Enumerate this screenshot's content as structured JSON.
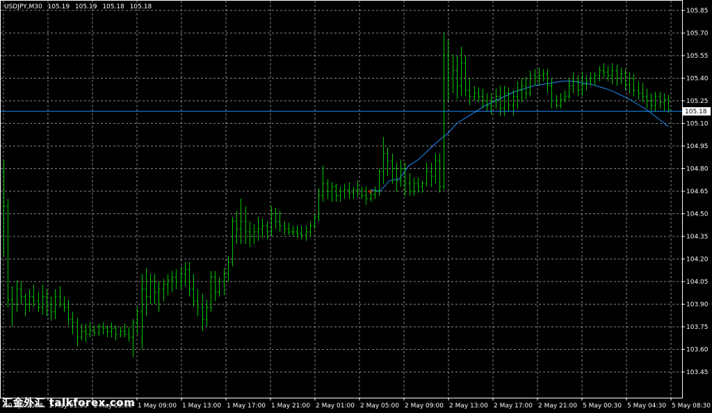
{
  "header": {
    "symbol": "USDJPY,M30",
    "open": "105.19",
    "high": "105.19",
    "low": "105.18",
    "close": "105.18"
  },
  "watermark": "汇金外汇 talkforex.com",
  "colors": {
    "background": "#000000",
    "grid": "#c0c0c0",
    "bars": "#00c800",
    "ma_line": "#1e90ff",
    "price_line": "#1e90ff",
    "arrow": "#ff0000",
    "axis_text": "#ffffff"
  },
  "chart_data": {
    "type": "ohlc",
    "price_label": "105.18",
    "ylim": [
      103.4,
      105.88
    ],
    "y_ticks": [
      "105.85",
      "105.70",
      "105.55",
      "105.40",
      "105.25",
      "105.10",
      "104.95",
      "104.80",
      "104.65",
      "104.50",
      "104.35",
      "104.20",
      "104.05",
      "103.90",
      "103.75",
      "103.60",
      "103.45"
    ],
    "x_ticks": [
      "30 Apr 2008",
      "1 May 01:00",
      "1 May 05:00",
      "1 May 09:00",
      "1 May 13:00",
      "1 May 17:00",
      "1 May 21:00",
      "2 May 01:00",
      "2 May 05:00",
      "2 May 09:00",
      "2 May 13:00",
      "2 May 17:00",
      "2 May 21:00",
      "5 May 00:30",
      "5 May 04:30",
      "5 May 08:30"
    ],
    "current_price": 105.18,
    "bars": [
      [
        104.78,
        104.86,
        104.22,
        104.55
      ],
      [
        104.55,
        104.6,
        103.88,
        103.93
      ],
      [
        103.93,
        104.02,
        103.75,
        103.9
      ],
      [
        103.9,
        104.06,
        103.85,
        104.0
      ],
      [
        104.0,
        104.05,
        103.9,
        103.95
      ],
      [
        103.95,
        103.97,
        103.82,
        103.9
      ],
      [
        103.9,
        104.0,
        103.85,
        103.95
      ],
      [
        103.95,
        104.03,
        103.88,
        103.92
      ],
      [
        103.92,
        103.98,
        103.85,
        103.88
      ],
      [
        103.88,
        104.03,
        103.83,
        103.95
      ],
      [
        103.95,
        104.0,
        103.82,
        103.9
      ],
      [
        103.9,
        103.95,
        103.79,
        103.85
      ],
      [
        103.85,
        104.0,
        103.8,
        103.95
      ],
      [
        103.95,
        104.02,
        103.88,
        103.9
      ],
      [
        103.9,
        103.95,
        103.85,
        103.88
      ],
      [
        103.88,
        103.93,
        103.76,
        103.8
      ],
      [
        103.8,
        103.85,
        103.7,
        103.78
      ],
      [
        103.78,
        103.81,
        103.62,
        103.68
      ],
      [
        103.68,
        103.77,
        103.66,
        103.72
      ],
      [
        103.72,
        103.77,
        103.65,
        103.7
      ],
      [
        103.7,
        103.78,
        103.68,
        103.73
      ],
      [
        103.73,
        103.76,
        103.69,
        103.71
      ],
      [
        103.71,
        103.77,
        103.69,
        103.75
      ],
      [
        103.75,
        103.78,
        103.7,
        103.74
      ],
      [
        103.74,
        103.76,
        103.68,
        103.72
      ],
      [
        103.72,
        103.78,
        103.68,
        103.74
      ],
      [
        103.74,
        103.76,
        103.66,
        103.7
      ],
      [
        103.7,
        103.75,
        103.68,
        103.72
      ],
      [
        103.72,
        103.77,
        103.68,
        103.7
      ],
      [
        103.7,
        103.75,
        103.65,
        103.68
      ],
      [
        103.68,
        103.8,
        103.55,
        103.78
      ],
      [
        103.78,
        103.88,
        103.7,
        103.85
      ],
      [
        103.85,
        104.1,
        103.6,
        104.0
      ],
      [
        104.0,
        104.14,
        103.82,
        103.95
      ],
      [
        103.95,
        104.1,
        103.9,
        104.05
      ],
      [
        104.05,
        104.1,
        103.9,
        103.98
      ],
      [
        103.98,
        104.05,
        103.85,
        104.0
      ],
      [
        104.0,
        104.07,
        103.92,
        104.03
      ],
      [
        104.03,
        104.1,
        103.96,
        104.06
      ],
      [
        104.06,
        104.12,
        103.98,
        104.08
      ],
      [
        104.08,
        104.13,
        104.0,
        104.05
      ],
      [
        104.05,
        104.15,
        104.0,
        104.1
      ],
      [
        104.1,
        104.18,
        104.02,
        104.13
      ],
      [
        104.13,
        104.18,
        103.95,
        104.0
      ],
      [
        104.0,
        104.1,
        103.88,
        103.92
      ],
      [
        103.92,
        104.0,
        103.82,
        103.88
      ],
      [
        103.88,
        103.97,
        103.72,
        103.8
      ],
      [
        103.8,
        103.93,
        103.75,
        103.88
      ],
      [
        103.88,
        104.12,
        103.85,
        104.08
      ],
      [
        104.08,
        104.12,
        103.92,
        103.98
      ],
      [
        103.98,
        104.08,
        103.95,
        104.05
      ],
      [
        104.05,
        104.14,
        103.96,
        104.1
      ],
      [
        104.1,
        104.22,
        104.05,
        104.18
      ],
      [
        104.18,
        104.48,
        104.15,
        104.45
      ],
      [
        104.45,
        104.52,
        104.3,
        104.4
      ],
      [
        104.4,
        104.6,
        104.3,
        104.45
      ],
      [
        104.45,
        104.55,
        104.3,
        104.38
      ],
      [
        104.38,
        104.45,
        104.28,
        104.35
      ],
      [
        104.35,
        104.43,
        104.3,
        104.38
      ],
      [
        104.38,
        104.48,
        104.32,
        104.4
      ],
      [
        104.4,
        104.47,
        104.34,
        104.42
      ],
      [
        104.42,
        104.45,
        104.33,
        104.38
      ],
      [
        104.38,
        104.55,
        104.35,
        104.5
      ],
      [
        104.5,
        104.54,
        104.4,
        104.45
      ],
      [
        104.45,
        104.52,
        104.38,
        104.42
      ],
      [
        104.42,
        104.45,
        104.36,
        104.4
      ],
      [
        104.4,
        104.44,
        104.36,
        104.38
      ],
      [
        104.38,
        104.42,
        104.35,
        104.38
      ],
      [
        104.38,
        104.42,
        104.34,
        104.37
      ],
      [
        104.37,
        104.42,
        104.33,
        104.36
      ],
      [
        104.36,
        104.42,
        104.32,
        104.38
      ],
      [
        104.38,
        104.45,
        104.35,
        104.42
      ],
      [
        104.42,
        104.5,
        104.4,
        104.48
      ],
      [
        104.48,
        104.67,
        104.45,
        104.62
      ],
      [
        104.62,
        104.82,
        104.58,
        104.7
      ],
      [
        104.7,
        104.73,
        104.6,
        104.65
      ],
      [
        104.65,
        104.71,
        104.58,
        104.68
      ],
      [
        104.68,
        104.7,
        104.58,
        104.62
      ],
      [
        104.62,
        104.68,
        104.58,
        104.65
      ],
      [
        104.65,
        104.7,
        104.6,
        104.66
      ],
      [
        104.66,
        104.71,
        104.6,
        104.64
      ],
      [
        104.64,
        104.68,
        104.6,
        104.66
      ],
      [
        104.66,
        104.72,
        104.61,
        104.65
      ],
      [
        104.65,
        104.68,
        104.6,
        104.62
      ],
      [
        104.62,
        104.68,
        104.56,
        104.6
      ],
      [
        104.6,
        104.66,
        104.58,
        104.63
      ],
      [
        104.63,
        104.68,
        104.6,
        104.65
      ],
      [
        104.65,
        104.8,
        104.62,
        104.78
      ],
      [
        104.78,
        105.01,
        104.7,
        104.9
      ],
      [
        104.9,
        104.94,
        104.75,
        104.85
      ],
      [
        104.85,
        104.9,
        104.7,
        104.8
      ],
      [
        104.8,
        104.84,
        104.65,
        104.72
      ],
      [
        104.72,
        104.86,
        104.68,
        104.8
      ],
      [
        104.8,
        104.84,
        104.62,
        104.7
      ],
      [
        104.7,
        104.77,
        104.62,
        104.65
      ],
      [
        104.65,
        104.74,
        104.62,
        104.7
      ],
      [
        104.7,
        104.74,
        104.64,
        104.68
      ],
      [
        104.68,
        104.72,
        104.64,
        104.7
      ],
      [
        104.7,
        104.84,
        104.68,
        104.78
      ],
      [
        104.78,
        104.84,
        104.68,
        104.75
      ],
      [
        104.75,
        104.9,
        104.7,
        104.85
      ],
      [
        104.85,
        104.9,
        104.64,
        104.68
      ],
      [
        104.68,
        105.7,
        104.66,
        105.55
      ],
      [
        105.55,
        105.66,
        105.25,
        105.4
      ],
      [
        105.4,
        105.56,
        105.3,
        105.45
      ],
      [
        105.45,
        105.55,
        105.26,
        105.35
      ],
      [
        105.35,
        105.61,
        105.28,
        105.5
      ],
      [
        105.5,
        105.55,
        105.28,
        105.32
      ],
      [
        105.32,
        105.4,
        105.22,
        105.28
      ],
      [
        105.28,
        105.35,
        105.25,
        105.3
      ],
      [
        105.3,
        105.34,
        105.24,
        105.28
      ],
      [
        105.28,
        105.33,
        105.2,
        105.25
      ],
      [
        105.25,
        105.3,
        105.18,
        105.22
      ],
      [
        105.22,
        105.3,
        105.16,
        105.25
      ],
      [
        105.25,
        105.33,
        105.2,
        105.28
      ],
      [
        105.28,
        105.35,
        105.15,
        105.2
      ],
      [
        105.2,
        105.35,
        105.15,
        105.3
      ],
      [
        105.3,
        105.34,
        105.18,
        105.22
      ],
      [
        105.22,
        105.32,
        105.15,
        105.28
      ],
      [
        105.28,
        105.38,
        105.2,
        105.32
      ],
      [
        105.32,
        105.4,
        105.24,
        105.35
      ],
      [
        105.35,
        105.41,
        105.26,
        105.3
      ],
      [
        105.3,
        105.45,
        105.28,
        105.42
      ],
      [
        105.42,
        105.46,
        105.35,
        105.4
      ],
      [
        105.4,
        105.47,
        105.35,
        105.42
      ],
      [
        105.42,
        105.46,
        105.38,
        105.43
      ],
      [
        105.43,
        105.46,
        105.3,
        105.35
      ],
      [
        105.35,
        105.4,
        105.2,
        105.25
      ],
      [
        105.25,
        105.29,
        105.2,
        105.22
      ],
      [
        105.22,
        105.3,
        105.2,
        105.26
      ],
      [
        105.26,
        105.32,
        105.24,
        105.28
      ],
      [
        105.28,
        105.4,
        105.26,
        105.35
      ],
      [
        105.35,
        105.44,
        105.3,
        105.38
      ],
      [
        105.38,
        105.42,
        105.28,
        105.32
      ],
      [
        105.32,
        105.44,
        105.28,
        105.36
      ],
      [
        105.36,
        105.42,
        105.32,
        105.38
      ],
      [
        105.38,
        105.44,
        105.35,
        105.4
      ],
      [
        105.4,
        105.44,
        105.35,
        105.42
      ],
      [
        105.42,
        105.48,
        105.38,
        105.45
      ],
      [
        105.45,
        105.5,
        105.4,
        105.44
      ],
      [
        105.44,
        105.48,
        105.38,
        105.42
      ],
      [
        105.42,
        105.5,
        105.36,
        105.45
      ],
      [
        105.45,
        105.49,
        105.35,
        105.4
      ],
      [
        105.4,
        105.47,
        105.36,
        105.43
      ],
      [
        105.43,
        105.46,
        105.32,
        105.36
      ],
      [
        105.36,
        105.44,
        105.3,
        105.4
      ],
      [
        105.4,
        105.43,
        105.28,
        105.32
      ],
      [
        105.32,
        105.38,
        105.26,
        105.3
      ],
      [
        105.3,
        105.37,
        105.24,
        105.28
      ],
      [
        105.28,
        105.33,
        105.2,
        105.25
      ],
      [
        105.25,
        105.3,
        105.18,
        105.22
      ],
      [
        105.22,
        105.31,
        105.18,
        105.28
      ],
      [
        105.28,
        105.31,
        105.2,
        105.24
      ],
      [
        105.24,
        105.3,
        105.18,
        105.26
      ],
      [
        105.26,
        105.29,
        105.17,
        105.19
      ]
    ],
    "ma_line": [
      [
        104.66,
        104.65
      ],
      [
        104.72,
        104.73
      ],
      [
        104.82,
        104.86
      ],
      [
        104.92,
        104.98
      ],
      [
        105.03,
        105.1
      ],
      [
        105.14,
        105.18
      ],
      [
        105.22,
        105.25
      ],
      [
        105.28,
        105.31
      ],
      [
        105.33,
        105.35
      ],
      [
        105.36,
        105.37
      ],
      [
        105.38,
        105.38
      ],
      [
        105.37,
        105.36
      ],
      [
        105.34,
        105.32
      ],
      [
        105.29,
        105.26
      ],
      [
        105.22,
        105.18
      ],
      [
        105.13,
        105.08
      ]
    ],
    "arrow_price": 104.64
  }
}
